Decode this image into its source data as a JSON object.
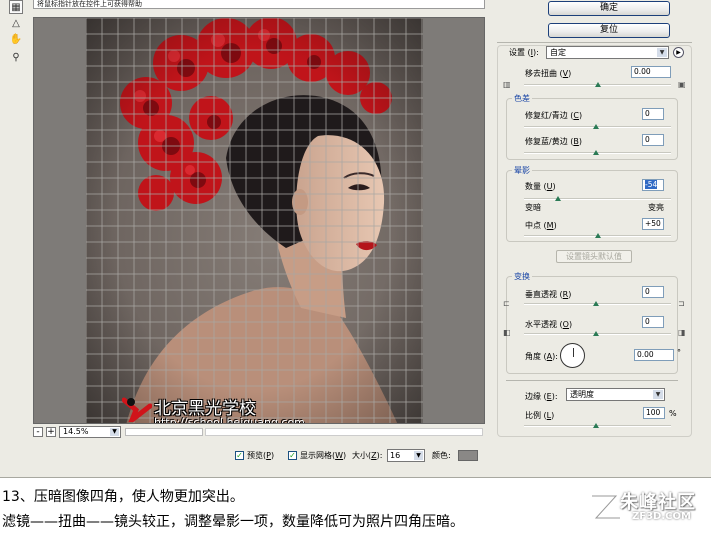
{
  "hint": "将鼠标指针放在控件上可获得帮助",
  "buttons": {
    "ok": "确定",
    "reset": "复位",
    "lens_default": "设置镜头默认值"
  },
  "settings": {
    "label": "设置",
    "key": "I",
    "value": "自定"
  },
  "distortion": {
    "label": "移去扭曲",
    "key": "V",
    "value": "0.00"
  },
  "chromatic": {
    "title": "色差",
    "red_cyan": {
      "label": "修复红/青边",
      "key": "C",
      "value": "0"
    },
    "blue_yellow": {
      "label": "修复蓝/黄边",
      "key": "B",
      "value": "0"
    }
  },
  "vignette": {
    "title": "晕影",
    "amount": {
      "label": "数量",
      "key": "U",
      "value": "-54",
      "slider_fraction": 0.23
    },
    "darken": "变暗",
    "lighten": "变亮",
    "midpoint": {
      "label": "中点",
      "key": "M",
      "value": "+50",
      "slider_fraction": 0.5
    }
  },
  "transform": {
    "title": "变换",
    "vertical": {
      "label": "垂直透视",
      "key": "R",
      "value": "0"
    },
    "horizontal": {
      "label": "水平透视",
      "key": "O",
      "value": "0"
    },
    "angle": {
      "label": "角度",
      "key": "A",
      "value": "0.00",
      "unit": "°"
    }
  },
  "edge": {
    "label": "边缘",
    "key": "E",
    "value": "透明度"
  },
  "scale": {
    "label": "比例",
    "key": "L",
    "value": "100",
    "unit": "%"
  },
  "zoom": {
    "value": "14.5%",
    "minus": "-",
    "plus": "+"
  },
  "options": {
    "preview": {
      "label": "预览",
      "key": "P",
      "checked": true
    },
    "show_grid": {
      "label": "显示网格",
      "key": "W",
      "checked": true
    },
    "size": {
      "label": "大小",
      "key": "Z",
      "value": "16"
    },
    "color": {
      "label": "颜色:",
      "swatch": "#8a8886"
    }
  },
  "watermark": {
    "title": "北京黑光学校",
    "url": "http://school.heiguang.com"
  },
  "caption": {
    "line1": "13、压暗图像四角，使人物更加突出。",
    "line2": "滤镜——扭曲——镜头较正，调整晕影一项，数量降低可为照片四角压暗。"
  },
  "site": {
    "name": "朱峰社区",
    "url": "ZF3D.COM"
  },
  "colors": {
    "accent_blue": "#1a46a6",
    "slider_green": "#2a7a55",
    "flower_red": "#c0141a"
  },
  "icons": [
    "remove-distortion-tool-icon",
    "straighten-tool-icon",
    "hand-tool-icon",
    "zoom-tool-icon"
  ]
}
